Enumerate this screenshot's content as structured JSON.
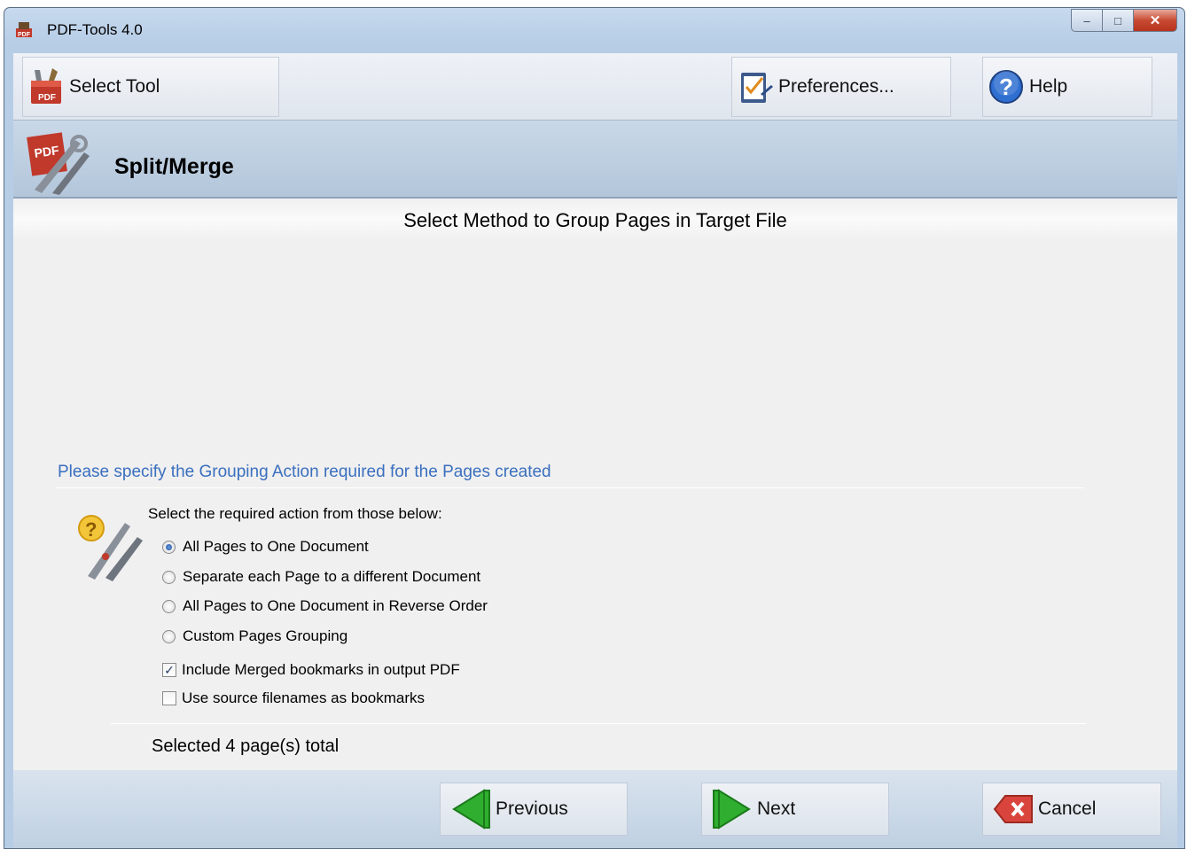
{
  "window": {
    "title": "PDF-Tools 4.0",
    "app_icon_text": "PDF"
  },
  "toolbar": {
    "select_tool": "Select Tool",
    "preferences": "Preferences...",
    "help": "Help"
  },
  "header": {
    "title": "Split/Merge"
  },
  "step": {
    "title": "Select Method to Group Pages in Target File"
  },
  "grouping": {
    "section_label": "Please specify the Grouping Action required for the Pages created",
    "instruction": "Select the required action from those below:",
    "options": [
      {
        "label": "All Pages to One Document",
        "checked": true
      },
      {
        "label": "Separate each Page to a different Document",
        "checked": false
      },
      {
        "label": "All Pages to One Document in Reverse Order",
        "checked": false
      },
      {
        "label": "Custom Pages Grouping",
        "checked": false
      }
    ],
    "checkboxes": [
      {
        "label": "Include Merged bookmarks in output PDF",
        "checked": true
      },
      {
        "label": "Use source filenames as bookmarks",
        "checked": false
      }
    ],
    "status": "Selected 4 page(s) total"
  },
  "footer": {
    "previous": "Previous",
    "next": "Next",
    "cancel": "Cancel"
  },
  "colors": {
    "accent_label": "#3a6fbf",
    "nav_arrow": "#2fae2f",
    "cancel_icon": "#d9453c"
  }
}
